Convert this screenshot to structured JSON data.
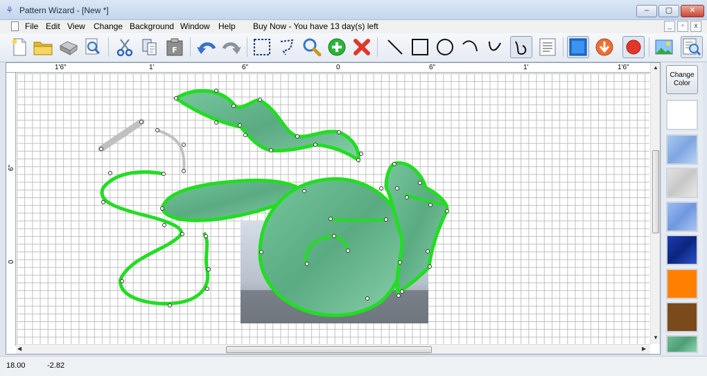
{
  "window": {
    "title": "Pattern Wizard - [New *]",
    "minimize": "‒",
    "maximize": "▢",
    "close": "✕"
  },
  "menu": {
    "items": [
      "File",
      "Edit",
      "View",
      "Change",
      "Background",
      "Window",
      "Help"
    ],
    "buy_now": "Buy Now - You have 13 day(s) left"
  },
  "toolbar": {
    "buttons": [
      "new-document",
      "open-folder",
      "print",
      "print-preview",
      "cut",
      "copy",
      "paste-f",
      "undo",
      "redo",
      "select-rectangle",
      "lasso",
      "zoom",
      "add-node",
      "delete-node",
      "line",
      "rectangle",
      "circle",
      "arc",
      "curve",
      "freehand",
      "text-list",
      "fill-blue",
      "arrow-down",
      "record",
      "background-image",
      "zoom-page"
    ],
    "pressed": [
      "freehand",
      "fill-blue",
      "record"
    ]
  },
  "rulers": {
    "top_labels": [
      "1'6\"",
      "1'",
      "6\"",
      "0",
      "6\"",
      "1'",
      "1'6\""
    ],
    "left_labels": [
      "6\"",
      "0"
    ]
  },
  "side_panel": {
    "change_color_label": "Change Color",
    "swatches": [
      "white",
      "light-blue-glass",
      "gray-texture",
      "blue-glass",
      "dark-blue-glass",
      "orange",
      "brown",
      "green-glass"
    ],
    "swatch_colors": [
      "#ffffff",
      "#9fbfe8",
      "#d6d6d6",
      "#8fb3ea",
      "#1d3fb0",
      "#ff8000",
      "#7a4a1c",
      "#5fb887"
    ]
  },
  "status": {
    "x": "18.00",
    "y": "-2.82"
  },
  "colors": {
    "shape_outline": "#22dd22",
    "shape_fill": "#6fbf93",
    "grid": "#bfbfbf",
    "selection": "#c0c0c0"
  }
}
